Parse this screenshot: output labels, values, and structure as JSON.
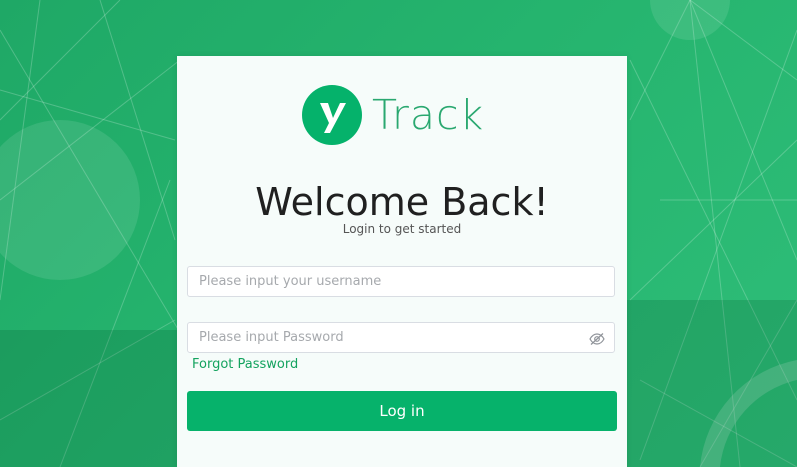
{
  "brand": {
    "name": "Track",
    "logo_icon": "y-logo-icon",
    "accent": "#05b26b"
  },
  "login": {
    "title": "Welcome Back!",
    "subtitle": "Login to get started",
    "username_placeholder": "Please input your username",
    "password_placeholder": "Please input Password",
    "password_toggle_icon": "eye-slash-icon",
    "forgot_label": "Forgot Password",
    "login_label": "Log in"
  },
  "colors": {
    "background": "#25b46e",
    "card": "#f6fcfa",
    "button": "#06b26b",
    "link": "#14a35f"
  }
}
